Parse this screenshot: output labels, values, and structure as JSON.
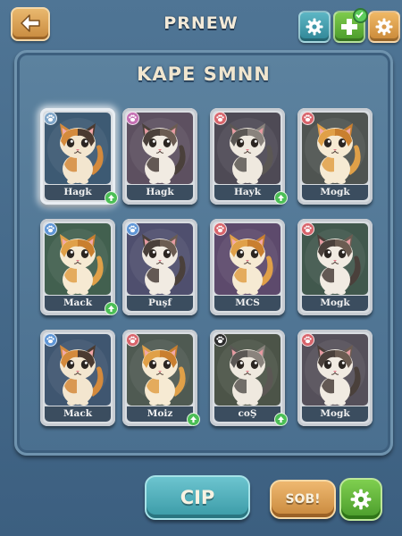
{
  "header": {
    "title": "PRNEW",
    "back_icon": "back-arrow-icon",
    "actions": [
      {
        "name": "settings-teal",
        "icon": "gear-icon",
        "color": "#3f97a8"
      },
      {
        "name": "add",
        "icon": "plus-icon",
        "color": "#5eae37",
        "badge": "checkmark"
      },
      {
        "name": "settings-orange",
        "icon": "gear-icon",
        "color": "#d89a4c"
      }
    ]
  },
  "panel": {
    "title": "KAPE SMNN"
  },
  "cats": [
    {
      "name": "Hagk",
      "paw": "#7fa6c9",
      "bg": "#3d5a73",
      "fur": "calico",
      "upgrade": true,
      "selected": true
    },
    {
      "name": "Hagk",
      "paw": "#c56fb3",
      "bg": "#5d5060",
      "fur": "dark",
      "upgrade": false,
      "selected": false
    },
    {
      "name": "Hayk",
      "paw": "#d8646b",
      "bg": "#4e4a55",
      "fur": "grey",
      "upgrade": true,
      "selected": false
    },
    {
      "name": "Mogk",
      "paw": "#d8646b",
      "bg": "#4f5451",
      "fur": "orange",
      "upgrade": false,
      "selected": false
    },
    {
      "name": "Mack",
      "paw": "#5f96d6",
      "bg": "#42604f",
      "fur": "orange",
      "upgrade": true,
      "selected": false
    },
    {
      "name": "Puşf",
      "paw": "#5f96d6",
      "bg": "#4f4f6e",
      "fur": "dark",
      "upgrade": false,
      "selected": false
    },
    {
      "name": "MCS",
      "paw": "#d8646b",
      "bg": "#5d4a6c",
      "fur": "orange",
      "upgrade": false,
      "selected": false
    },
    {
      "name": "Mogk",
      "paw": "#d8646b",
      "bg": "#41584d",
      "fur": "dark",
      "upgrade": false,
      "selected": false
    },
    {
      "name": "Mack",
      "paw": "#5f96d6",
      "bg": "#3f5670",
      "fur": "calico",
      "upgrade": false,
      "selected": false
    },
    {
      "name": "Moiz",
      "paw": "#d8646b",
      "bg": "#4f5a52",
      "fur": "orange",
      "upgrade": true,
      "selected": false
    },
    {
      "name": "coŞ",
      "paw": "#2a2a2a",
      "bg": "#4c5448",
      "fur": "grey",
      "upgrade": true,
      "selected": false
    },
    {
      "name": "Mogk",
      "paw": "#d8646b",
      "bg": "#55505a",
      "fur": "dark",
      "upgrade": false,
      "selected": false
    }
  ],
  "footer": {
    "primary_label": "CIP",
    "secondary_label": "SOB!",
    "gear_icon": "gear-icon"
  }
}
